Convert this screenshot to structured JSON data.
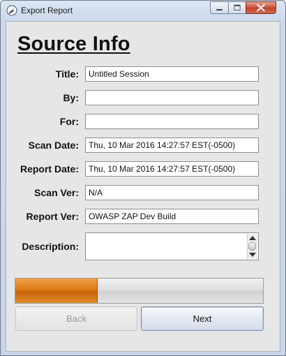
{
  "window": {
    "title": "Export Report"
  },
  "form": {
    "heading": "Source Info",
    "fields": [
      {
        "label": "Title:",
        "value": "Untitled Session"
      },
      {
        "label": "By:",
        "value": ""
      },
      {
        "label": "For:",
        "value": ""
      },
      {
        "label": "Scan Date:",
        "value": "Thu, 10 Mar 2016 14:27:57 EST(-0500)"
      },
      {
        "label": "Report Date:",
        "value": "Thu, 10 Mar 2016 14:27:57 EST(-0500)"
      },
      {
        "label": "Scan Ver:",
        "value": "N/A"
      },
      {
        "label": "Report Ver:",
        "value": "OWASP ZAP Dev Build"
      }
    ],
    "description": {
      "label": "Description:",
      "value": ""
    }
  },
  "progress": {
    "fraction": 0.33,
    "color": "#dd7a16"
  },
  "buttons": {
    "back": "Back",
    "next": "Next"
  },
  "icons": {
    "app": "zap-app-icon",
    "minimize": "minimize-icon",
    "maximize": "maximize-icon",
    "close": "close-icon"
  }
}
